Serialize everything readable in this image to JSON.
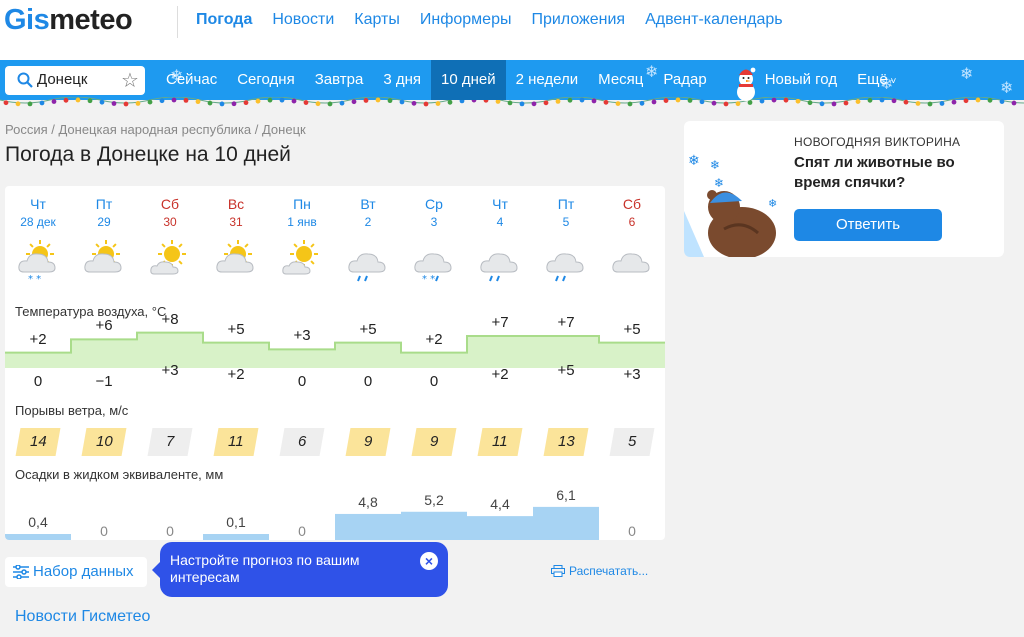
{
  "logo": {
    "gis": "Gis",
    "meteo": "meteo"
  },
  "top_nav": [
    "Погода",
    "Новости",
    "Карты",
    "Информеры",
    "Приложения",
    "Адвент-календарь"
  ],
  "search": {
    "value": "Донецк"
  },
  "blue_nav": [
    "Сейчас",
    "Сегодня",
    "Завтра",
    "3 дня",
    "10 дней",
    "2 недели",
    "Месяц",
    "Радар",
    "Новый год",
    "Ещё"
  ],
  "blue_nav_active": "10 дней",
  "breadcrumb": "Россия / Донецкая народная республика / Донецк",
  "page_title": "Погода в Донецке на 10 дней",
  "days": [
    {
      "name": "Чт",
      "date": "28 дек",
      "color": "blue",
      "icon": "partly-cloudy-snow"
    },
    {
      "name": "Пт",
      "date": "29",
      "color": "blue",
      "icon": "cloudy-sun"
    },
    {
      "name": "Сб",
      "date": "30",
      "color": "red",
      "icon": "sun-cloud"
    },
    {
      "name": "Вс",
      "date": "31",
      "color": "red",
      "icon": "cloudy-sun"
    },
    {
      "name": "Пн",
      "date": "1 янв",
      "color": "blue",
      "icon": "sun-cloud"
    },
    {
      "name": "Вт",
      "date": "2",
      "color": "blue",
      "icon": "cloud-rain"
    },
    {
      "name": "Ср",
      "date": "3",
      "color": "blue",
      "icon": "cloud-snow"
    },
    {
      "name": "Чт",
      "date": "4",
      "color": "blue",
      "icon": "cloud-rain"
    },
    {
      "name": "Пт",
      "date": "5",
      "color": "blue",
      "icon": "cloud-rain"
    },
    {
      "name": "Сб",
      "date": "6",
      "color": "red",
      "icon": "cloud"
    }
  ],
  "labels": {
    "temperature": "Температура воздуха, °C",
    "wind": "Порывы ветра, м/с",
    "precip": "Осадки в жидком эквиваленте, мм"
  },
  "temp_max": [
    "+2",
    "+6",
    "+8",
    "+5",
    "+3",
    "+5",
    "+2",
    "+7",
    "+7",
    "+5"
  ],
  "temp_min": [
    "0",
    "−1",
    "+3",
    "+2",
    "0",
    "0",
    "0",
    "+2",
    "+5",
    "+3"
  ],
  "temp_max_values": [
    2,
    6,
    8,
    5,
    3,
    5,
    2,
    7,
    7,
    5
  ],
  "wind_gusts": [
    "14",
    "10",
    "7",
    "11",
    "6",
    "9",
    "9",
    "11",
    "13",
    "5"
  ],
  "wind_colors": [
    "#fbe49a",
    "#fbe49a",
    "#eeeeee",
    "#fbe49a",
    "#eeeeee",
    "#fbe49a",
    "#fbe49a",
    "#fbe49a",
    "#fbe49a",
    "#eeeeee"
  ],
  "precip": [
    "0,4",
    "0",
    "0",
    "0,1",
    "0",
    "4,8",
    "5,2",
    "4,4",
    "6,1",
    "0"
  ],
  "precip_values": [
    0.4,
    0,
    0,
    0.1,
    0,
    4.8,
    5.2,
    4.4,
    6.1,
    0
  ],
  "promo": {
    "eyebrow": "НОВОГОДНЯЯ ВИКТОРИНА",
    "question": "Спят ли животные во время спячки?",
    "button": "Ответить"
  },
  "dataset_button": "Набор данных",
  "tooltip": "Настройте прогноз по вашим интересам",
  "print_link": "Распечатать...",
  "news_link": "Новости Гисметео",
  "colors": {
    "brand_blue": "#1e88e5",
    "bar_blue": "#1e9af0",
    "temp_fill": "#d8f2c8",
    "temp_line": "#a9dc8a",
    "precip_fill": "#a7d3f3"
  }
}
